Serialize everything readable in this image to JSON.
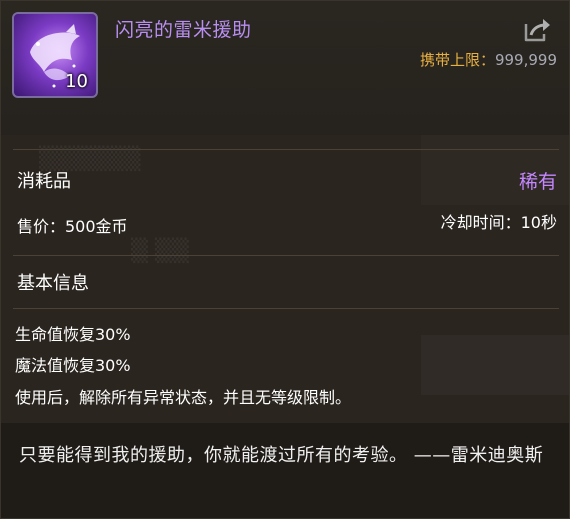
{
  "item": {
    "name": "闪亮的雷米援助",
    "stack_count": "10",
    "carry_limit_label": "携带上限：",
    "carry_limit_value": "999,999"
  },
  "details": {
    "type": "消耗品",
    "rarity": "稀有",
    "price": "售价：500金币",
    "cooldown": "冷却时间：10秒",
    "section_title": "基本信息",
    "effects": [
      "生命值恢复30%",
      "魔法值恢复30%",
      "使用后，解除所有异常状态，并且无等级限制。"
    ]
  },
  "quote": "只要能得到我的援助，你就能渡过所有的考验。 ——雷米迪奥斯",
  "colors": {
    "item_name": "#b88ff0",
    "rarity": "#c487ff",
    "carry_label": "#e7b042",
    "carry_value": "#a9a9b3"
  },
  "icons": {
    "item": "fairy-wing-icon",
    "share": "share-arrow-icon"
  }
}
